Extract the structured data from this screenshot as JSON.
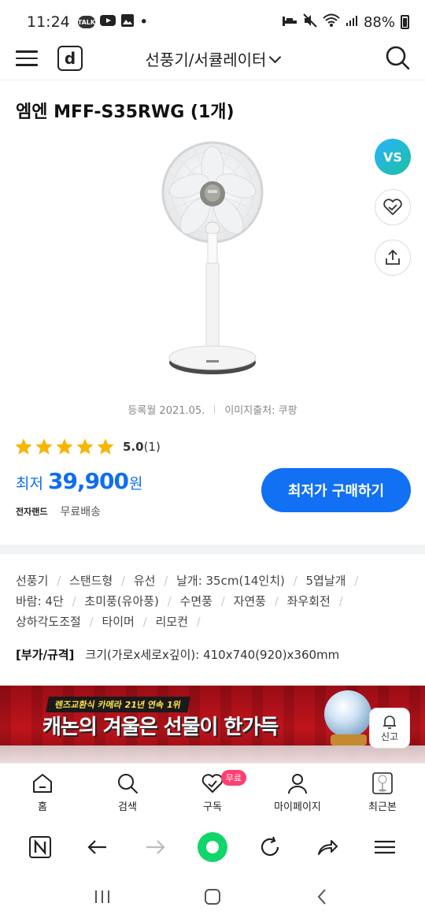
{
  "status_bar": {
    "time": "11:24",
    "talk_badge": "TALK",
    "dot": "•",
    "battery": "88%"
  },
  "header": {
    "logo_letter": "d",
    "category": "선풍기/서큘레이터"
  },
  "product": {
    "title": "엠엔 MFF-S35RWG (1개)",
    "vs_label": "VS",
    "registered": "등록월 2021.05.",
    "image_source": "이미지출처: 쿠팡",
    "rating_score": "5.0",
    "rating_count": "(1)",
    "rating_stars": 5,
    "price_label": "최저",
    "price": "39,900",
    "price_unit": "원",
    "seller": "전자랜드",
    "shipping": "무료배송",
    "buy_button": "최저가 구매하기"
  },
  "spec": {
    "tags": [
      "선풍기",
      "스탠드형",
      "유선",
      "날개: 35cm(14인치)",
      "5엽날개",
      "바람: 4단",
      "초미풍(유아풍)",
      "수면풍",
      "자연풍",
      "좌우회전",
      "상하각도조절",
      "타이머",
      "리모컨"
    ],
    "size_key": "[부가/규격]",
    "size_value": "크기(가로x세로x깊이): 410x740(920)x360mm"
  },
  "banner": {
    "sub": "렌즈교환식 카메라 21년 연속 1위",
    "main": "캐논의 겨울은 선물이 한가득",
    "report": "신고"
  },
  "bottom_nav": {
    "items": [
      {
        "label": "홈",
        "icon": "home-icon"
      },
      {
        "label": "검색",
        "icon": "search-icon"
      },
      {
        "label": "구독",
        "icon": "heart-check-icon",
        "badge": "무료"
      },
      {
        "label": "마이페이지",
        "icon": "person-icon"
      },
      {
        "label": "최근본",
        "icon": "recent-thumb-icon"
      }
    ]
  },
  "colors": {
    "accent": "#1170f4",
    "price": "#0f6ef0",
    "star": "#f7b500",
    "badge": "#ff3f72",
    "green": "#0fd56b"
  }
}
